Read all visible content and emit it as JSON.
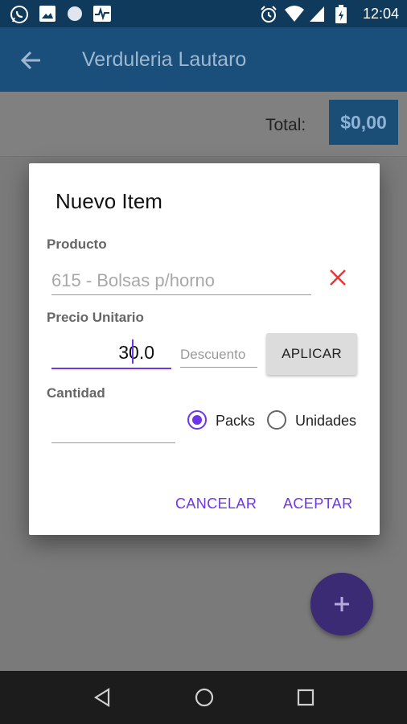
{
  "status_bar": {
    "time": "12:04",
    "left_icons": [
      "whatsapp-icon",
      "image-icon",
      "circle-icon",
      "activity-icon"
    ],
    "right_icons": [
      "alarm-icon",
      "wifi-icon",
      "signal-icon",
      "battery-icon"
    ]
  },
  "app_bar": {
    "title": "Verduleria Lautaro",
    "color": "#1a4f7c"
  },
  "summary": {
    "total_label": "Total:",
    "total_value": "$0,00"
  },
  "dialog": {
    "title": "Nuevo Item",
    "product": {
      "label": "Producto",
      "value": "615 - Bolsas p/horno"
    },
    "price": {
      "label": "Precio Unitario",
      "value": "30.0",
      "discount_placeholder": "Descuento",
      "apply_label": "APLICAR"
    },
    "quantity": {
      "label": "Cantidad",
      "value": "",
      "options": [
        "Packs",
        "Unidades"
      ],
      "selected": "Packs"
    },
    "cancel_label": "CANCELAR",
    "accept_label": "ACEPTAR",
    "accent": "#6f35e8"
  },
  "fab": {
    "icon": "plus-icon"
  },
  "nav": {
    "icons": [
      "back-icon",
      "home-icon",
      "recents-icon"
    ]
  }
}
